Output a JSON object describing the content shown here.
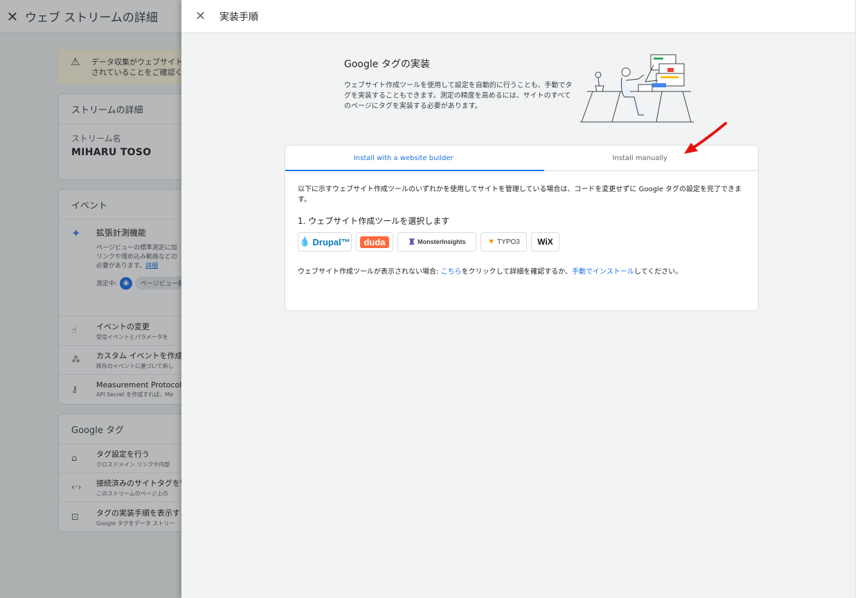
{
  "background": {
    "header": {
      "close_icon": "close-icon",
      "title": "ウェブ ストリームの詳細"
    },
    "warning": {
      "line1": "データ収集がウェブサイト",
      "line2": "されていることをご確認く"
    },
    "stream_card": {
      "header": "ストリームの詳細",
      "name_label": "ストリーム名",
      "name_value": "MIHARU TOSO"
    },
    "events_card": {
      "header": "イベント",
      "enhanced": {
        "title": "拡張計測機能",
        "desc1": "ページビューの標準測定に加",
        "desc2": "リンクや埋め込み動画などの",
        "desc3": "必要があります。",
        "link": "詳細",
        "measuring_label": "測定中:",
        "chip": "ページビュー数"
      },
      "items": [
        {
          "icon": "touch-icon",
          "title": "イベントの変更",
          "desc": "受信イベントとパラメータを"
        },
        {
          "icon": "sparkle-cursor-icon",
          "title": "カスタム イベントを作成",
          "desc": "既存のイベントに基づいて新し"
        },
        {
          "icon": "key-icon",
          "title": "Measurement Protocol AP",
          "desc": "API Secret を作成すれば、Me"
        }
      ]
    },
    "google_tag_card": {
      "header": "Google タグ",
      "items": [
        {
          "icon": "tag-icon",
          "title": "タグ設定を行う",
          "desc": "クロスドメイン リンクや内部"
        },
        {
          "icon": "code-arrows-icon",
          "title": "接続済みのサイトタグを管",
          "desc": "このストリームのページ上の"
        },
        {
          "icon": "code-box-icon",
          "title": "タグの実装手順を表示する",
          "desc": "Google タグをデータ ストリー"
        }
      ]
    }
  },
  "drawer": {
    "title": "実装手順",
    "intro": {
      "title": "Google タグの実装",
      "desc": "ウェブサイト作成ツールを使用して設定を自動的に行うことも、手動でタグを実装することもできます。測定の精度を高めるには、サイトのすべてのページにタグを実装する必要があります。"
    },
    "tabs": [
      {
        "label": "Install with a website builder",
        "active": true
      },
      {
        "label": "Install manually",
        "active": false
      }
    ],
    "panel": {
      "desc": "以下に示すウェブサイト作成ツールのいずれかを使用してサイトを管理している場合は、コードを変更せずに Google タグの設定を完了できます。",
      "step": "1. ウェブサイト作成ツールを選択します",
      "builders": [
        {
          "name": "Drupal",
          "label": "Drupal™"
        },
        {
          "name": "duda",
          "label": "duda"
        },
        {
          "name": "MonsterInsights",
          "label": "MonsterInsights"
        },
        {
          "name": "TYPO3",
          "label": "TYPO3"
        },
        {
          "name": "WiX",
          "label": "WiX"
        }
      ],
      "note_prefix": "ウェブサイト作成ツールが表示されない場合: ",
      "note_link1": "こちら",
      "note_middle": "をクリックして詳細を確認するか、",
      "note_link2": "手動でインストール",
      "note_suffix": "してください。"
    }
  },
  "colors": {
    "accent": "#1a73e8",
    "arrow": "#e8120c",
    "duda": "#ff6a3d",
    "drupal": "#0678be"
  }
}
